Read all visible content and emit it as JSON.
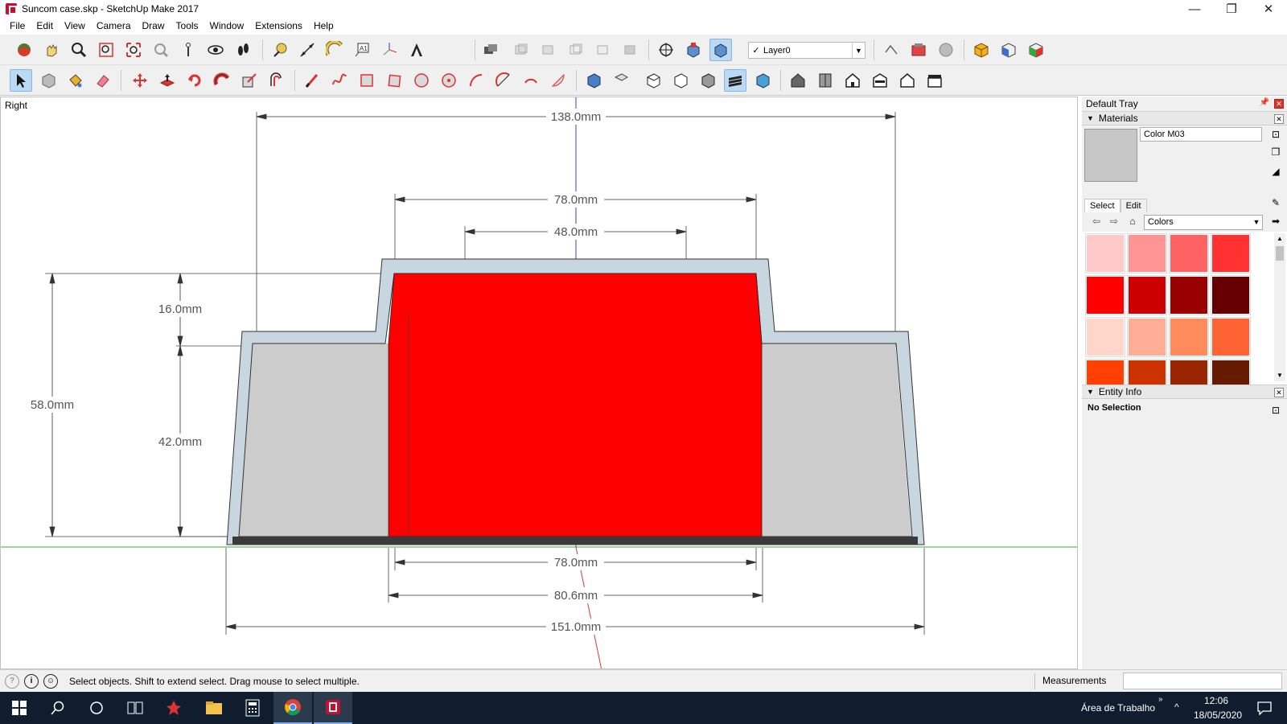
{
  "window": {
    "title": "Suncom case.skp - SketchUp Make 2017",
    "minimize": "—",
    "maximize": "❐",
    "close": "✕"
  },
  "menu": [
    "File",
    "Edit",
    "View",
    "Camera",
    "Draw",
    "Tools",
    "Window",
    "Extensions",
    "Help"
  ],
  "layer": {
    "check": "✓",
    "name": "Layer0"
  },
  "viewport": {
    "view_name": "Right",
    "dimensions": {
      "top_width": "138.0mm",
      "upper_width": "78.0mm",
      "inner_top": "48.0mm",
      "height_upper": "16.0mm",
      "height_total": "58.0mm",
      "height_lower": "42.0mm",
      "bottom_78": "78.0mm",
      "bottom_80": "80.6mm",
      "bottom_151": "151.0mm"
    },
    "colors": {
      "red_core": "#ff0000",
      "shell": "#c8d6e0",
      "gray_fill": "#cccccc",
      "base": "#3a3a3a",
      "axis_blue": "#3b3bbf",
      "axis_green": "#3aa83a",
      "axis_red": "#d23a3a"
    }
  },
  "tray": {
    "title": "Default Tray",
    "materials": {
      "header": "Materials",
      "current": "Color M03",
      "tab_select": "Select",
      "tab_edit": "Edit",
      "library": "Colors",
      "swatches": [
        [
          "#ffc9c9",
          "#ff9494",
          "#ff6262",
          "#ff3131"
        ],
        [
          "#ff0000",
          "#cc0000",
          "#990000",
          "#660000"
        ],
        [
          "#ffd6c9",
          "#ffad94",
          "#ff8a5c",
          "#ff6333"
        ],
        [
          "#ff4000",
          "#cc3300",
          "#992600",
          "#661a00"
        ]
      ]
    },
    "entity_info": {
      "header": "Entity Info",
      "selection": "No Selection"
    }
  },
  "status": {
    "message": "Select objects. Shift to extend select. Drag mouse to select multiple.",
    "measurements_label": "Measurements"
  },
  "taskbar": {
    "desktop": "Área de Trabalho",
    "time": "12:06",
    "date": "18/05/2020"
  }
}
